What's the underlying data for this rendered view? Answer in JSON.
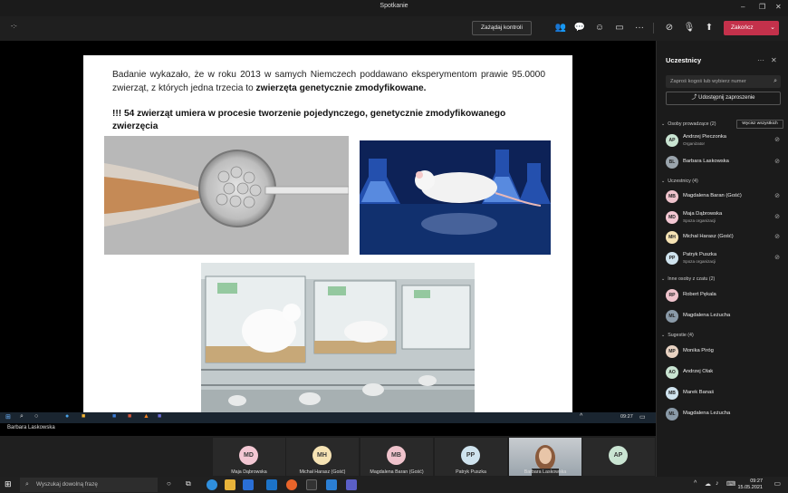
{
  "window": {
    "title": "Spotkanie"
  },
  "toolbar": {
    "timer": "-:-",
    "request_control": "Zażądaj kontroli",
    "leave": "Zakończ"
  },
  "slide": {
    "paragraph1_a": "Badanie wykazało, że w roku 2013 w samych Niemczech poddawano eksperymentom prawie 95.0000 zwierząt, z których jedna trzecia to ",
    "paragraph1_b": "zwierzęta genetycznie zmodyfikowane.",
    "paragraph2": "!!! 54 zwierząt umiera w procesie tworzenie pojedynczego, genetycznie zmodyfikowanego zwierzęcia"
  },
  "remote_taskbar": {
    "time": "09:27"
  },
  "presenter": "Barbara Laskowska",
  "gallery": [
    {
      "initials": "MD",
      "name": "Maja Dąbrowska",
      "color": "#f3c7d3"
    },
    {
      "initials": "MH",
      "name": "Michał Harasz (Gość)",
      "color": "#f6e3b4"
    },
    {
      "initials": "MB",
      "name": "Magdalena Baran (Gość)",
      "color": "#efc3cc"
    },
    {
      "initials": "PP",
      "name": "Patryk Puszka",
      "color": "#cfe3ee"
    },
    {
      "initials": "",
      "name": "Barbara Laskowska",
      "color": "#9aa4ac"
    },
    {
      "initials": "AP",
      "name": "",
      "color": "#c9e4d2"
    }
  ],
  "panel": {
    "title": "Uczestnicy",
    "search_placeholder": "Zaproś kogoś lub wybierz numer",
    "share_invite": "Udostępnij zaproszenie",
    "sections": {
      "presenters": "Osoby prowadzące (2)",
      "mute_all": "Wycisz wszystkich",
      "attendees": "Uczestnicy (4)",
      "in_chat": "Inne osoby z czatu (2)",
      "suggestions": "Sugestie (4)"
    },
    "presenters": [
      {
        "initials": "AP",
        "name": "Andrzej Pieczonka",
        "sub": "Organizator",
        "color": "#c9e4d2"
      },
      {
        "initials": "BL",
        "name": "Barbara Laskowska",
        "sub": "",
        "color": "#9aa4ac"
      }
    ],
    "attendees": [
      {
        "initials": "MB",
        "name": "Magdalena Baran (Gość)",
        "sub": "",
        "color": "#efc3cc"
      },
      {
        "initials": "MD",
        "name": "Maja Dąbrowska",
        "sub": "Spoza organizacji",
        "color": "#f3c7d3"
      },
      {
        "initials": "MH",
        "name": "Michał Harasz (Gość)",
        "sub": "",
        "color": "#f6e3b4"
      },
      {
        "initials": "PP",
        "name": "Patryk Puszka",
        "sub": "Spoza organizacji",
        "color": "#cfe3ee"
      }
    ],
    "in_chat": [
      {
        "initials": "RP",
        "name": "Robert Pękala",
        "color": "#efc3cc"
      },
      {
        "initials": "ML",
        "name": "Magdalena Leżucha",
        "color": "#8a9aa8"
      }
    ],
    "suggestions": [
      {
        "initials": "MP",
        "name": "Monika Piróg",
        "color": "#e8d2c2"
      },
      {
        "initials": "AO",
        "name": "Andrzej Olak",
        "color": "#c9e4d2"
      },
      {
        "initials": "MB",
        "name": "Marek Banaś",
        "color": "#cfe3ee"
      },
      {
        "initials": "ML",
        "name": "Magdalena Leżucha",
        "color": "#8a9aa8"
      }
    ]
  },
  "taskbar": {
    "search_placeholder": "Wyszukaj dowolną frazę",
    "time": "09:27",
    "date": "15.05.2021"
  }
}
